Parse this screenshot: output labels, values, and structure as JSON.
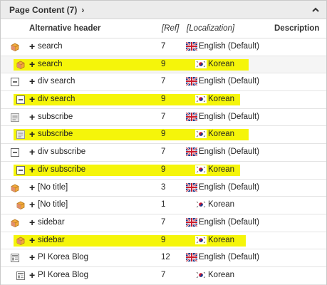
{
  "panel": {
    "title": "Page Content (7)",
    "chevron": "›"
  },
  "columns": {
    "alt_header": "Alternative header",
    "ref": "[Ref]",
    "localization": "[Localization]",
    "description": "Description"
  },
  "colors": {
    "highlight": "#f5f50a"
  },
  "rows": [
    {
      "icon": "content-cube-icon",
      "title": "search",
      "ref": "7",
      "lang": "English (Default)",
      "flag": "uk",
      "highlighted": false
    },
    {
      "icon": "content-cube-icon",
      "title": "search",
      "ref": "9",
      "lang": "Korean",
      "flag": "kr",
      "highlighted": true
    },
    {
      "icon": "div-box-icon",
      "title": "div search",
      "ref": "7",
      "lang": "English (Default)",
      "flag": "uk",
      "highlighted": false
    },
    {
      "icon": "div-box-icon",
      "title": "div search",
      "ref": "9",
      "lang": "Korean",
      "flag": "kr",
      "highlighted": true
    },
    {
      "icon": "form-icon",
      "title": "subscribe",
      "ref": "7",
      "lang": "English (Default)",
      "flag": "uk",
      "highlighted": false
    },
    {
      "icon": "form-icon",
      "title": "subscribe",
      "ref": "9",
      "lang": "Korean",
      "flag": "kr",
      "highlighted": true
    },
    {
      "icon": "div-box-icon",
      "title": "div subscribe",
      "ref": "7",
      "lang": "English (Default)",
      "flag": "uk",
      "highlighted": false
    },
    {
      "icon": "div-box-icon",
      "title": "div subscribe",
      "ref": "9",
      "lang": "Korean",
      "flag": "kr",
      "highlighted": true
    },
    {
      "icon": "content-cube-icon",
      "title": "[No title]",
      "ref": "3",
      "lang": "English (Default)",
      "flag": "uk",
      "highlighted": false
    },
    {
      "icon": "content-cube-icon",
      "title": "[No title]",
      "ref": "1",
      "lang": "Korean",
      "flag": "kr",
      "highlighted": false
    },
    {
      "icon": "content-cube-icon",
      "title": "sidebar",
      "ref": "7",
      "lang": "English (Default)",
      "flag": "uk",
      "highlighted": false
    },
    {
      "icon": "content-cube-icon",
      "title": "sidebar",
      "ref": "9",
      "lang": "Korean",
      "flag": "kr",
      "highlighted": true
    },
    {
      "icon": "news-list-icon",
      "title": "PI Korea Blog",
      "ref": "12",
      "lang": "English (Default)",
      "flag": "uk",
      "highlighted": false
    },
    {
      "icon": "news-list-icon",
      "title": "PI Korea Blog",
      "ref": "7",
      "lang": "Korean",
      "flag": "kr",
      "highlighted": false
    }
  ]
}
